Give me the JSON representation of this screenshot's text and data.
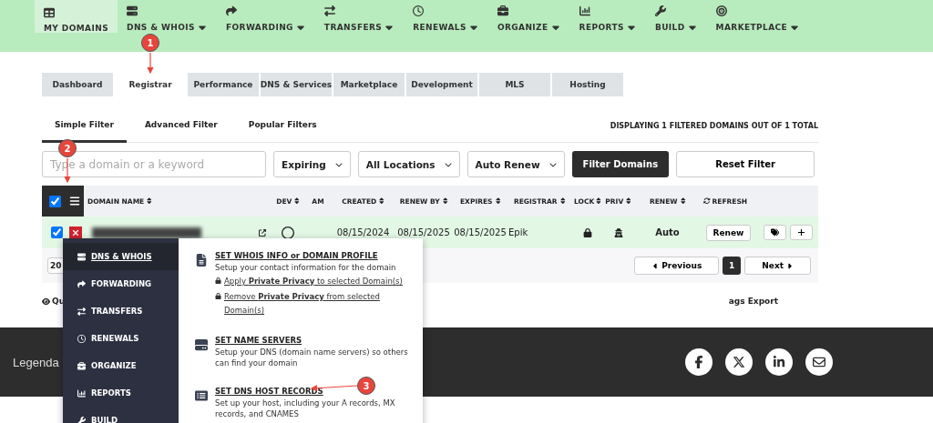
{
  "nav": {
    "items": [
      {
        "label": "MY DOMAINS",
        "selected": true,
        "dropdown": false
      },
      {
        "label": "DNS & WHOIS",
        "selected": false,
        "dropdown": true
      },
      {
        "label": "FORWARDING",
        "selected": false,
        "dropdown": true
      },
      {
        "label": "TRANSFERS",
        "selected": false,
        "dropdown": true
      },
      {
        "label": "RENEWALS",
        "selected": false,
        "dropdown": true
      },
      {
        "label": "ORGANIZE",
        "selected": false,
        "dropdown": true
      },
      {
        "label": "REPORTS",
        "selected": false,
        "dropdown": true
      },
      {
        "label": "BUILD",
        "selected": false,
        "dropdown": true
      },
      {
        "label": "MARKETPLACE",
        "selected": false,
        "dropdown": true
      }
    ]
  },
  "sub_tabs": [
    {
      "label": "Dashboard",
      "selected": false
    },
    {
      "label": "Registrar",
      "selected": true
    },
    {
      "label": "Performance",
      "selected": false
    },
    {
      "label": "DNS & Services",
      "selected": false
    },
    {
      "label": "Marketplace",
      "selected": false
    },
    {
      "label": "Development",
      "selected": false
    },
    {
      "label": "MLS",
      "selected": false
    },
    {
      "label": "Hosting",
      "selected": false
    }
  ],
  "filter_tabs": [
    {
      "label": "Simple Filter",
      "selected": true
    },
    {
      "label": "Advanced Filter",
      "selected": false
    },
    {
      "label": "Popular Filters",
      "selected": false
    }
  ],
  "display_count": "DISPLAYING 1 FILTERED DOMAINS OUT OF 1 TOTAL",
  "search": {
    "placeholder": "Type a domain or a keyword"
  },
  "selects": [
    {
      "label": "Expiring"
    },
    {
      "label": "All Locations"
    },
    {
      "label": "Auto Renew"
    }
  ],
  "filter_button": "Filter Domains",
  "reset_button": "Reset Filter",
  "table": {
    "select_all": true,
    "columns": [
      {
        "label": "DOMAIN NAME",
        "sortable": true
      },
      {
        "label": "DEV",
        "sortable": true
      },
      {
        "label": "AM",
        "sortable": false
      },
      {
        "label": "CREATED",
        "sortable": true
      },
      {
        "label": "RENEW BY",
        "sortable": true
      },
      {
        "label": "EXPIRES",
        "sortable": true
      },
      {
        "label": "REGISTRAR",
        "sortable": true
      },
      {
        "label": "LOCK",
        "sortable": true
      },
      {
        "label": "PRIV",
        "sortable": true
      },
      {
        "label": "RENEW",
        "sortable": true
      },
      {
        "label": "REFRESH",
        "sortable": false
      }
    ],
    "rows": [
      {
        "checked": true,
        "created": "08/15/2024",
        "renew_by": "08/15/2025",
        "expires": "08/15/2025",
        "registrar": "Epik",
        "renew": "Auto",
        "renew_button": "Renew"
      }
    ]
  },
  "pagination": {
    "page_size": "20",
    "previous": "Previous",
    "pages": [
      {
        "label": "1",
        "selected": true
      }
    ],
    "next": "Next"
  },
  "below_table": {
    "left": "Qu",
    "right": "ags Export"
  },
  "footer": {
    "brand": "Legenda"
  },
  "menu": {
    "categories": [
      {
        "label": "DNS & WHOIS",
        "selected": true
      },
      {
        "label": "FORWARDING",
        "selected": false
      },
      {
        "label": "TRANSFERS",
        "selected": false
      },
      {
        "label": "RENEWALS",
        "selected": false
      },
      {
        "label": "ORGANIZE",
        "selected": false
      },
      {
        "label": "REPORTS",
        "selected": false
      },
      {
        "label": "BUILD",
        "selected": false
      }
    ],
    "entries": [
      {
        "title": "SET WHOIS INFO or DOMAIN PROFILE",
        "description": "Setup your contact information for the domain",
        "links": [
          "Apply **Private Privacy** to selected Domain(s)",
          "Remove **Private Privacy** from selected Domain(s)"
        ]
      },
      {
        "title": "SET NAME SERVERS",
        "description": "Setup your DNS (domain name servers) so others can find your domain"
      },
      {
        "title": "SET DNS HOST RECORDS",
        "description": "Set up your host, including your A records, MX records, and CNAMES"
      }
    ]
  },
  "callouts": [
    "1",
    "2",
    "3"
  ]
}
